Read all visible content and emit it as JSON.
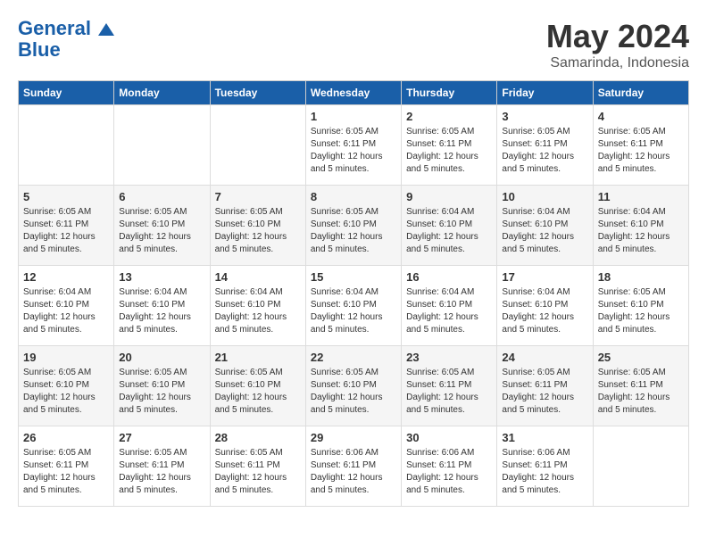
{
  "header": {
    "logo_line1": "General",
    "logo_line2": "Blue",
    "month": "May 2024",
    "location": "Samarinda, Indonesia"
  },
  "weekdays": [
    "Sunday",
    "Monday",
    "Tuesday",
    "Wednesday",
    "Thursday",
    "Friday",
    "Saturday"
  ],
  "weeks": [
    [
      {
        "day": "",
        "info": ""
      },
      {
        "day": "",
        "info": ""
      },
      {
        "day": "",
        "info": ""
      },
      {
        "day": "1",
        "info": "Sunrise: 6:05 AM\nSunset: 6:11 PM\nDaylight: 12 hours\nand 5 minutes."
      },
      {
        "day": "2",
        "info": "Sunrise: 6:05 AM\nSunset: 6:11 PM\nDaylight: 12 hours\nand 5 minutes."
      },
      {
        "day": "3",
        "info": "Sunrise: 6:05 AM\nSunset: 6:11 PM\nDaylight: 12 hours\nand 5 minutes."
      },
      {
        "day": "4",
        "info": "Sunrise: 6:05 AM\nSunset: 6:11 PM\nDaylight: 12 hours\nand 5 minutes."
      }
    ],
    [
      {
        "day": "5",
        "info": "Sunrise: 6:05 AM\nSunset: 6:11 PM\nDaylight: 12 hours\nand 5 minutes."
      },
      {
        "day": "6",
        "info": "Sunrise: 6:05 AM\nSunset: 6:10 PM\nDaylight: 12 hours\nand 5 minutes."
      },
      {
        "day": "7",
        "info": "Sunrise: 6:05 AM\nSunset: 6:10 PM\nDaylight: 12 hours\nand 5 minutes."
      },
      {
        "day": "8",
        "info": "Sunrise: 6:05 AM\nSunset: 6:10 PM\nDaylight: 12 hours\nand 5 minutes."
      },
      {
        "day": "9",
        "info": "Sunrise: 6:04 AM\nSunset: 6:10 PM\nDaylight: 12 hours\nand 5 minutes."
      },
      {
        "day": "10",
        "info": "Sunrise: 6:04 AM\nSunset: 6:10 PM\nDaylight: 12 hours\nand 5 minutes."
      },
      {
        "day": "11",
        "info": "Sunrise: 6:04 AM\nSunset: 6:10 PM\nDaylight: 12 hours\nand 5 minutes."
      }
    ],
    [
      {
        "day": "12",
        "info": "Sunrise: 6:04 AM\nSunset: 6:10 PM\nDaylight: 12 hours\nand 5 minutes."
      },
      {
        "day": "13",
        "info": "Sunrise: 6:04 AM\nSunset: 6:10 PM\nDaylight: 12 hours\nand 5 minutes."
      },
      {
        "day": "14",
        "info": "Sunrise: 6:04 AM\nSunset: 6:10 PM\nDaylight: 12 hours\nand 5 minutes."
      },
      {
        "day": "15",
        "info": "Sunrise: 6:04 AM\nSunset: 6:10 PM\nDaylight: 12 hours\nand 5 minutes."
      },
      {
        "day": "16",
        "info": "Sunrise: 6:04 AM\nSunset: 6:10 PM\nDaylight: 12 hours\nand 5 minutes."
      },
      {
        "day": "17",
        "info": "Sunrise: 6:04 AM\nSunset: 6:10 PM\nDaylight: 12 hours\nand 5 minutes."
      },
      {
        "day": "18",
        "info": "Sunrise: 6:05 AM\nSunset: 6:10 PM\nDaylight: 12 hours\nand 5 minutes."
      }
    ],
    [
      {
        "day": "19",
        "info": "Sunrise: 6:05 AM\nSunset: 6:10 PM\nDaylight: 12 hours\nand 5 minutes."
      },
      {
        "day": "20",
        "info": "Sunrise: 6:05 AM\nSunset: 6:10 PM\nDaylight: 12 hours\nand 5 minutes."
      },
      {
        "day": "21",
        "info": "Sunrise: 6:05 AM\nSunset: 6:10 PM\nDaylight: 12 hours\nand 5 minutes."
      },
      {
        "day": "22",
        "info": "Sunrise: 6:05 AM\nSunset: 6:10 PM\nDaylight: 12 hours\nand 5 minutes."
      },
      {
        "day": "23",
        "info": "Sunrise: 6:05 AM\nSunset: 6:11 PM\nDaylight: 12 hours\nand 5 minutes."
      },
      {
        "day": "24",
        "info": "Sunrise: 6:05 AM\nSunset: 6:11 PM\nDaylight: 12 hours\nand 5 minutes."
      },
      {
        "day": "25",
        "info": "Sunrise: 6:05 AM\nSunset: 6:11 PM\nDaylight: 12 hours\nand 5 minutes."
      }
    ],
    [
      {
        "day": "26",
        "info": "Sunrise: 6:05 AM\nSunset: 6:11 PM\nDaylight: 12 hours\nand 5 minutes."
      },
      {
        "day": "27",
        "info": "Sunrise: 6:05 AM\nSunset: 6:11 PM\nDaylight: 12 hours\nand 5 minutes."
      },
      {
        "day": "28",
        "info": "Sunrise: 6:05 AM\nSunset: 6:11 PM\nDaylight: 12 hours\nand 5 minutes."
      },
      {
        "day": "29",
        "info": "Sunrise: 6:06 AM\nSunset: 6:11 PM\nDaylight: 12 hours\nand 5 minutes."
      },
      {
        "day": "30",
        "info": "Sunrise: 6:06 AM\nSunset: 6:11 PM\nDaylight: 12 hours\nand 5 minutes."
      },
      {
        "day": "31",
        "info": "Sunrise: 6:06 AM\nSunset: 6:11 PM\nDaylight: 12 hours\nand 5 minutes."
      },
      {
        "day": "",
        "info": ""
      }
    ]
  ]
}
